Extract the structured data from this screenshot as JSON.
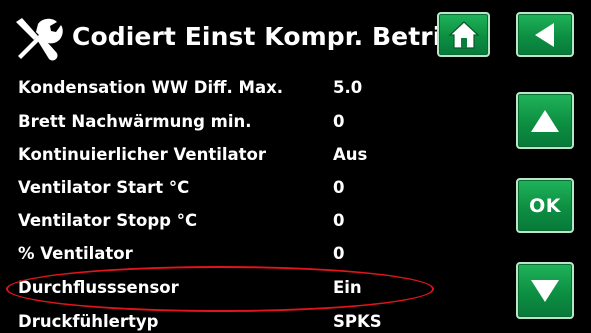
{
  "header": {
    "title": "Codiert Einst Kompr. Betrieb",
    "icon": "tools-icon"
  },
  "nav": {
    "home_icon": "home-icon",
    "back_icon": "back-arrow-icon",
    "up_icon": "up-arrow-icon",
    "ok_label": "OK",
    "down_icon": "down-arrow-icon",
    "button_color": "#0d8f42"
  },
  "settings": [
    {
      "label": "Kondensation WW Diff. Max.",
      "value": "5.0"
    },
    {
      "label": "Brett Nachwärmung min.",
      "value": "0"
    },
    {
      "label": "Kontinuierlicher Ventilator",
      "value": "Aus"
    },
    {
      "label": "Ventilator Start °C",
      "value": "0"
    },
    {
      "label": "Ventilator Stopp °C",
      "value": "0"
    },
    {
      "label": "% Ventilator",
      "value": "0"
    },
    {
      "label": "Durchflusssensor",
      "value": "Ein"
    },
    {
      "label": "Druckfühlertyp",
      "value": "SPKS"
    }
  ],
  "annotation": {
    "highlight_color": "#e0141c",
    "highlighted_row": "Durchflusssensor"
  }
}
